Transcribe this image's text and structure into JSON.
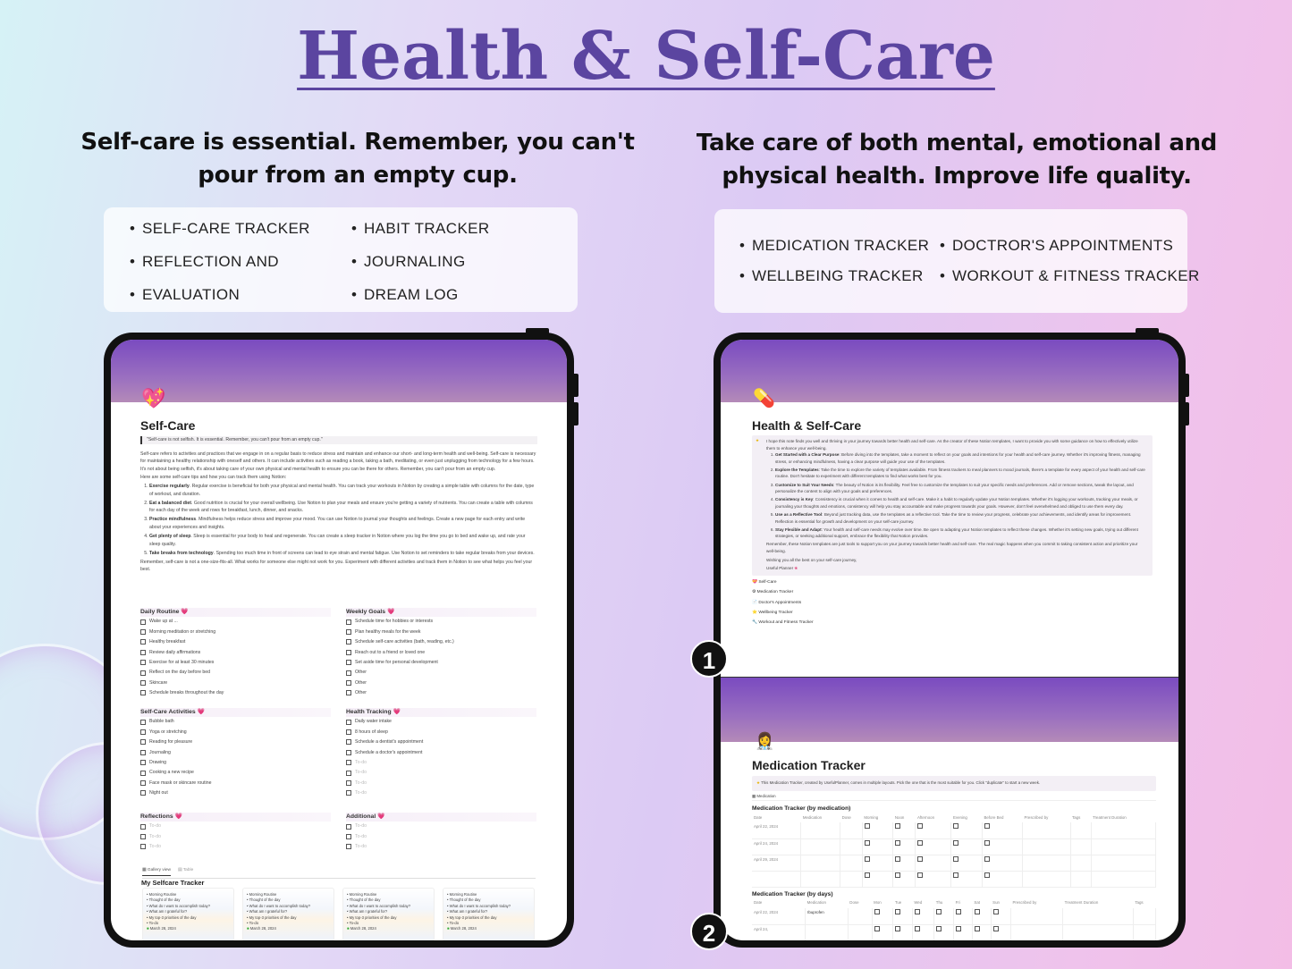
{
  "header": {
    "title": "Health & Self-Care",
    "left_subtitle": [
      "Self-care is essential. Remember, you can't",
      "pour from an empty cup."
    ],
    "right_subtitle": [
      "Take care of both mental, emotional and",
      "physical health. Improve life quality."
    ]
  },
  "left_features": [
    "SELF-CARE TRACKER",
    "REFLECTION AND",
    "EVALUATION",
    "HABIT TRACKER",
    "JOURNALING",
    "DREAM LOG"
  ],
  "right_features": [
    "MEDICATION TRACKER",
    "WELLBEING TRACKER",
    "DOCTROR'S APPOINTMENTS",
    "WORKOUT & FITNESS TRACKER"
  ],
  "selfcare": {
    "icon": "sparkling-heart-icon",
    "title": "Self-Care",
    "quote": "\"Self-care is not selfish. It is essential. Remember, you can't pour from an empty cup.\"",
    "intro": "Self-care refers to activities and practices that we engage in on a regular basis to reduce stress and maintain and enhance our short- and long-term health and well-being. Self-care is necessary for maintaining a healthy relationship with oneself and others. It can include activities such as reading a book, taking a bath, meditating, or even just unplugging from technology for a few hours. It's not about being selfish, it's about taking care of your own physical and mental health to ensure you can be there for others. Remember, you can't pour from an empty cup.",
    "tips_lead": "Here are some self-care tips and how you can track them using Notion:",
    "tips": [
      {
        "bold": "Exercise regularly",
        "text": ". Regular exercise is beneficial for both your physical and mental health. You can track your workouts in Notion by creating a simple table with columns for the date, type of workout, and duration."
      },
      {
        "bold": "Eat a balanced diet",
        "text": ". Good nutrition is crucial for your overall wellbeing. Use Notion to plan your meals and ensure you're getting a variety of nutrients. You can create a table with columns for each day of the week and rows for breakfast, lunch, dinner, and snacks."
      },
      {
        "bold": "Practice mindfulness",
        "text": ". Mindfulness helps reduce stress and improve your mood. You can use Notion to journal your thoughts and feelings. Create a new page for each entry and write about your experiences and insights."
      },
      {
        "bold": "Get plenty of sleep",
        "text": ". Sleep is essential for your body to heal and regenerate. You can create a sleep tracker in Notion where you log the time you go to bed and wake up, and rate your sleep quality."
      },
      {
        "bold": "Take breaks from technology",
        "text": ". Spending too much time in front of screens can lead to eye strain and mental fatigue. Use Notion to set reminders to take regular breaks from your devices."
      }
    ],
    "outro": "Remember, self-care is not a one-size-fits-all. What works for someone else might not work for you. Experiment with different activities and track them in Notion to see what helps you feel your best.",
    "sections": [
      {
        "title": "Daily Routine",
        "items": [
          "Wake up at ...",
          "Morning meditation or stretching",
          "Healthy breakfast",
          "Review daily affirmations",
          "Exercise for at least 30 minutes",
          "Reflect on the day before bed",
          "Skincare",
          "Schedule breaks throughout the day"
        ]
      },
      {
        "title": "Weekly Goals",
        "items": [
          "Schedule time for hobbies or interests",
          "Plan healthy meals for the week",
          "Schedule self-care activities (bath, reading, etc.)",
          "Reach out to a friend or loved one",
          "Set aside time for personal development",
          "Other",
          "Other",
          "Other"
        ]
      },
      {
        "title": "Self-Care Activities",
        "items": [
          "Bubble bath",
          "Yoga or stretching",
          "Reading for pleasure",
          "Journaling",
          "Drawing",
          "Cooking a new recipe",
          "Face mask or skincare routine",
          "Night out"
        ]
      },
      {
        "title": "Health Tracking",
        "items": [
          "Daily water intake",
          "8 hours of sleep",
          "Schedule a dentist's appointment",
          "Schedule a doctor's appointment"
        ],
        "placeholders": [
          "To-do",
          "To-do",
          "To-do",
          "To-do"
        ]
      },
      {
        "title": "Reflections",
        "items": [],
        "placeholders": [
          "To-do",
          "To-do",
          "To-do"
        ]
      },
      {
        "title": "Additional",
        "items": [],
        "placeholders": [
          "To-do",
          "To-do",
          "To-do"
        ]
      }
    ],
    "views": [
      "Gallery view",
      "Table"
    ],
    "tracker_title": "My Selfcare Tracker",
    "card_items": [
      "Morning Routine",
      "Thought of the day",
      "What do I want to accomplish today?",
      "What am I grateful for?",
      "My top-3 priorities of the day",
      "To-do"
    ],
    "card_date": "March 28, 2024"
  },
  "health": {
    "icon": "pill-icon",
    "title": "Health & Self-Care",
    "intro": "I hope this note finds you well and thriving in your journey towards better health and self-care. As the creator of these Notion templates, I want to provide you with some guidance on how to effectively utilize them to enhance your well-being.",
    "steps": [
      {
        "bold": "Get Started with a Clear Purpose",
        "text": ": Before diving into the templates, take a moment to reflect on your goals and intentions for your health and self-care journey. Whether it's improving fitness, managing stress, or enhancing mindfulness, having a clear purpose will guide your use of the templates."
      },
      {
        "bold": "Explore the Templates",
        "text": ": Take the time to explore the variety of templates available. From fitness trackers to meal planners to mood journals, there's a template for every aspect of your health and self-care routine. Don't hesitate to experiment with different templates to find what works best for you."
      },
      {
        "bold": "Customize to Suit Your Needs",
        "text": ": The beauty of Notion is its flexibility. Feel free to customize the templates to suit your specific needs and preferences. Add or remove sections, tweak the layout, and personalize the content to align with your goals and preferences."
      },
      {
        "bold": "Consistency is Key",
        "text": ": Consistency is crucial when it comes to health and self-care. Make it a habit to regularly update your Notion templates. Whether it's logging your workouts, tracking your meals, or journaling your thoughts and emotions, consistency will help you stay accountable and make progress towards your goals. However, don't feel overwhelmed and obliged to use them every day."
      },
      {
        "bold": "Use as a Reflective Tool",
        "text": ": Beyond just tracking data, use the templates as a reflective tool. Take the time to review your progress, celebrate your achievements, and identify areas for improvement. Reflection is essential for growth and development on your self-care journey."
      },
      {
        "bold": "Stay Flexible and Adapt",
        "text": ": Your health and self-care needs may evolve over time. Be open to adapting your Notion templates to reflect these changes. Whether it's setting new goals, trying out different strategies, or seeking additional support, embrace the flexibility that Notion provides."
      }
    ],
    "closing": "Remember, these Notion templates are just tools to support you on your journey towards better health and self-care. The real magic happens when you commit to taking consistent action and prioritize your well-being.",
    "wish": "Wishing you all the best on your self-care journey,",
    "signature": "Useful Planner",
    "links": [
      "Self-Care",
      "Medication Tracker",
      "Doctor's Appointments",
      "Wellbeing Tracker",
      "Workout and Fitness Tracker"
    ]
  },
  "medication": {
    "title": "Medication Tracker",
    "callout": "This Medication Tracker, created by UsefulPlanner, comes in multiple layouts. Pick the one that is the most suitable for you. Click \"duplicate\" to start a new week.",
    "view": "Medication",
    "table1_title": "Medication Tracker (by medication)",
    "table1_cols": [
      "Date",
      "Medication",
      "Dose",
      "Morning",
      "Noon",
      "Afternoon",
      "Evening",
      "Before Bed",
      "Prescribed by",
      "Tags",
      "Treatment Duration"
    ],
    "table1_rows": [
      [
        "April 22, 2024"
      ],
      [
        "April 24, 2024"
      ],
      [
        "April 29, 2024"
      ],
      [
        ""
      ]
    ],
    "table2_title": "Medication Tracker (by days)",
    "table2_cols": [
      "Date",
      "Medication",
      "Dose",
      "Mon",
      "Tue",
      "Wed",
      "Thu",
      "Fri",
      "Sat",
      "Sun",
      "Prescribed by",
      "Treatment Duration",
      "Tags"
    ],
    "table2_rows": [
      [
        "April 22, 2024",
        "Ibuprofen"
      ],
      [
        "April 24,",
        ""
      ]
    ]
  },
  "badges": [
    "1",
    "2"
  ],
  "colors": {
    "title": "#5b45a0",
    "cover": "#7a4bc0",
    "accent": "#e0457b"
  }
}
